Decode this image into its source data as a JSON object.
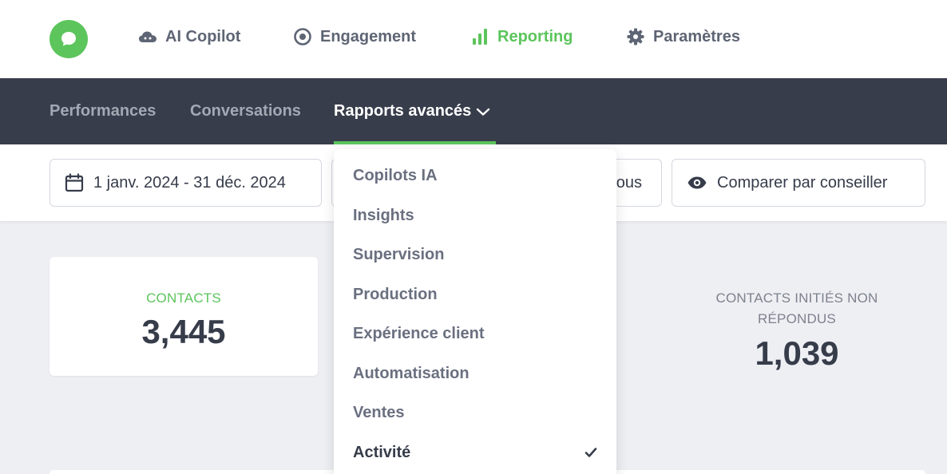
{
  "topnav": {
    "items": [
      {
        "label": "AI Copilot",
        "icon": "cloud-icon"
      },
      {
        "label": "Engagement",
        "icon": "target-icon"
      },
      {
        "label": "Reporting",
        "icon": "bar-chart-icon",
        "active": true
      },
      {
        "label": "Paramètres",
        "icon": "gear-icon"
      }
    ]
  },
  "subnav": {
    "items": [
      {
        "label": "Performances"
      },
      {
        "label": "Conversations"
      },
      {
        "label": "Rapports avancés",
        "active": true
      }
    ]
  },
  "filters": {
    "date_range": "1 janv. 2024 - 31 déc. 2024",
    "hidden_filter_tail": "ous",
    "compare": "Comparer par conseiller"
  },
  "stats": {
    "contacts": {
      "label": "CONTACTS",
      "value": "3,445"
    },
    "unanswered": {
      "label": "CONTACTS INITIÉS NON RÉPONDUS",
      "value": "1,039"
    }
  },
  "dropdown": {
    "items": [
      {
        "label": "Copilots IA"
      },
      {
        "label": "Insights"
      },
      {
        "label": "Supervision"
      },
      {
        "label": "Production"
      },
      {
        "label": "Expérience client"
      },
      {
        "label": "Automatisation"
      },
      {
        "label": "Ventes"
      },
      {
        "label": "Activité",
        "selected": true
      }
    ]
  },
  "colors": {
    "accent": "#5cc55c",
    "dark_nav": "#373d4b",
    "background": "#eeeff3"
  }
}
